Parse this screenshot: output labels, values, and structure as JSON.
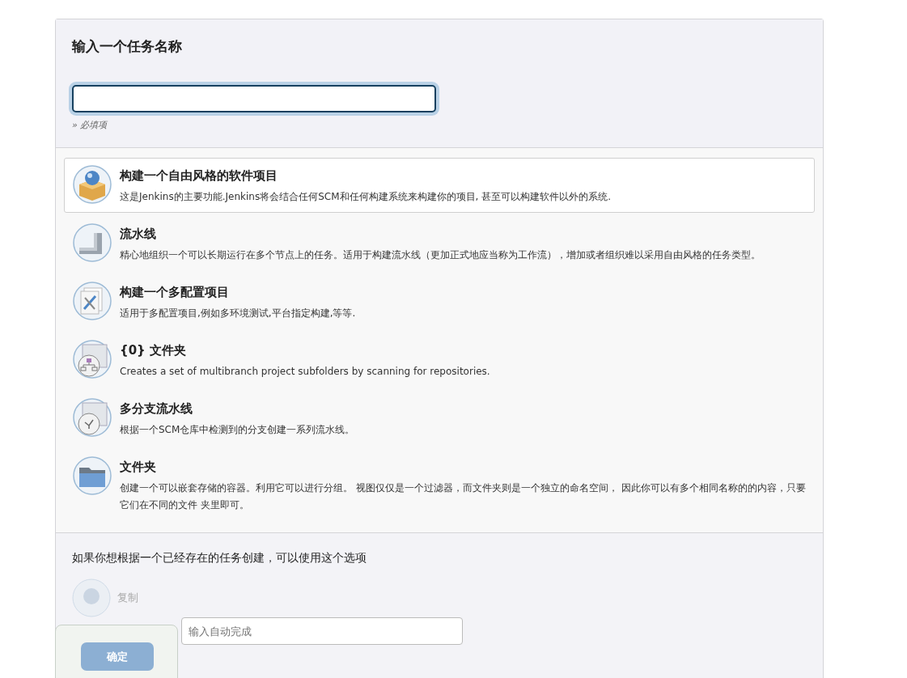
{
  "name_section": {
    "title": "输入一个任务名称",
    "required_hint": "» 必填项"
  },
  "job_types": [
    {
      "kind": "freestyle",
      "title": "构建一个自由风格的软件项目",
      "description": "这是Jenkins的主要功能.Jenkins将会结合任何SCM和任何构建系统来构建你的项目, 甚至可以构建软件以外的系统.",
      "selected": true
    },
    {
      "kind": "pipeline",
      "title": "流水线",
      "description": "精心地组织一个可以长期运行在多个节点上的任务。适用于构建流水线（更加正式地应当称为工作流），增加或者组织难以采用自由风格的任务类型。",
      "selected": false
    },
    {
      "kind": "matrix",
      "title": "构建一个多配置项目",
      "description": "适用于多配置项目,例如多环境测试,平台指定构建,等等.",
      "selected": false
    },
    {
      "kind": "org-folder",
      "title": "{0} 文件夹",
      "description": "Creates a set of multibranch project subfolders by scanning for repositories.",
      "selected": false
    },
    {
      "kind": "multibranch",
      "title": "多分支流水线",
      "description": "根据一个SCM仓库中检测到的分支创建一系列流水线。",
      "selected": false
    },
    {
      "kind": "folder",
      "title": "文件夹",
      "description": "创建一个可以嵌套存储的容器。利用它可以进行分组。 视图仅仅是一个过滤器，而文件夹则是一个独立的命名空间， 因此你可以有多个相同名称的的内容，只要它们在不同的文件 夹里即可。",
      "selected": false
    }
  ],
  "copy_section": {
    "hint": "如果你想根据一个已经存在的任务创建，可以使用这个选项",
    "label": "复制",
    "placeholder": "输入自动完成"
  },
  "footer": {
    "ok_button": "确定"
  }
}
